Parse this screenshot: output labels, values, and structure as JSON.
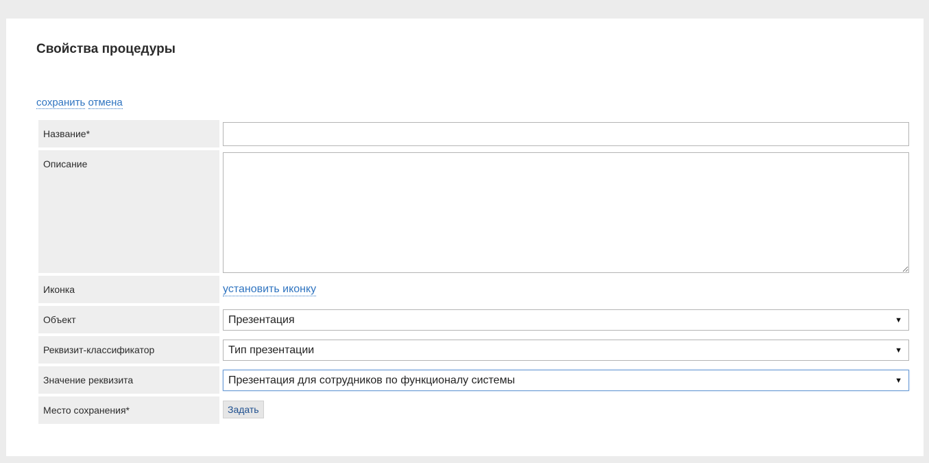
{
  "page": {
    "title": "Свойства процедуры"
  },
  "actions": {
    "save": "сохранить",
    "cancel": "отмена"
  },
  "form": {
    "name_label": "Название*",
    "name_value": "",
    "description_label": "Описание",
    "description_value": "",
    "icon_label": "Иконка",
    "icon_link": "установить иконку",
    "object_label": "Объект",
    "object_value": "Презентация",
    "classifier_label": "Реквизит-классификатор",
    "classifier_value": "Тип презентации",
    "attr_value_label": "Значение реквизита",
    "attr_value_value": "Презентация для сотрудников по функционалу системы",
    "save_place_label": "Место сохранения*",
    "save_place_button": "Задать"
  },
  "icons": {
    "dropdown": "triangle-down"
  }
}
